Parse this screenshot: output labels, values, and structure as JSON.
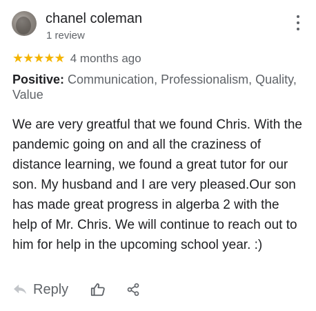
{
  "reviewer": {
    "name": "chanel coleman",
    "review_count": "1 review"
  },
  "rating": {
    "stars": "★★★★★",
    "value": 5,
    "max": 5,
    "star_color": "#f4b400",
    "date": "4 months ago"
  },
  "attributes": {
    "label": "Positive:",
    "text": "Communication, Professionalism, Quality, Value"
  },
  "review_text": "We are very greatful that we found Chris. With the pandemic going on and all the craziness of distance learning, we found a great tutor for our son. My husband and I are very pleased.Our son has made great progress in algerba 2 with the help of Mr. Chris. We will continue to reach out to him for help in the upcoming school year. :)",
  "actions": {
    "reply_label": "Reply",
    "reply_icon": "reply-icon",
    "like_icon": "thumbs-up-icon",
    "share_icon": "share-icon",
    "more_icon": "more-vertical-icon"
  },
  "colors": {
    "text_primary": "#202124",
    "text_secondary": "#5f6368",
    "background": "#ffffff"
  }
}
